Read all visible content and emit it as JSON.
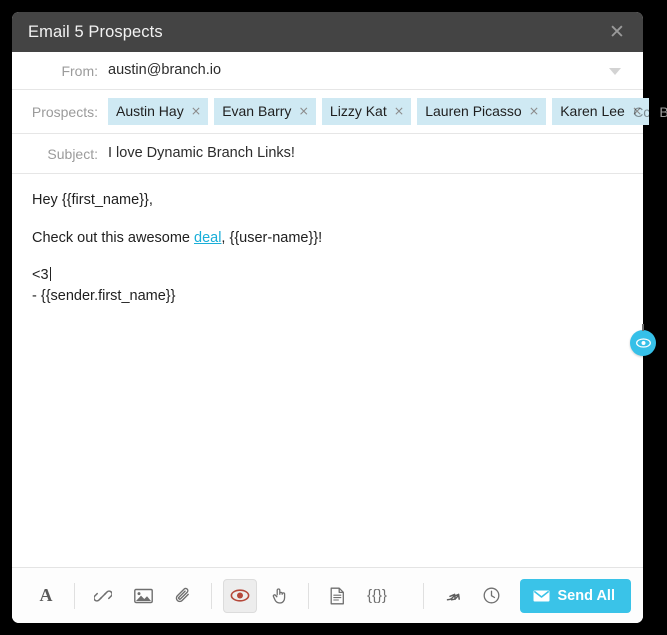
{
  "window": {
    "title": "Email 5 Prospects",
    "close_label": "✕",
    "header_bg": "#444444",
    "accent": "#3ac3e8"
  },
  "fields": {
    "from": {
      "label": "From:",
      "value": "austin@branch.io",
      "dropdown_icon": "chevron-down-icon"
    },
    "prospects": {
      "label": "Prospects:",
      "chips": [
        {
          "name": "Austin Hay",
          "remove": "×"
        },
        {
          "name": "Evan Barry",
          "remove": "×"
        },
        {
          "name": "Lizzy Kat",
          "remove": "×"
        },
        {
          "name": "Lauren Picasso",
          "remove": "×"
        },
        {
          "name": "Karen Lee",
          "remove": "×"
        }
      ],
      "cc_label": "Cc",
      "bcc_label": "Bcc",
      "chip_bg": "#cfe9f3"
    },
    "subject": {
      "label": "Subject:",
      "value": "I love Dynamic Branch Links!"
    }
  },
  "body": {
    "greeting": "Hey {{first_name}},",
    "line2_before": "Check out this awesome ",
    "line2_link": "deal",
    "line2_after": ", {{user-name}}!",
    "sign": "<3",
    "signature": "- {{sender.first_name}}",
    "link_color": "#19aed8"
  },
  "preview_badge": {
    "icon": "eye-icon",
    "color": "#36c0e8"
  },
  "toolbar": {
    "left_tools": [
      {
        "icon": "font-icon",
        "label": "A",
        "active": false
      },
      {
        "icon": "link-icon",
        "label": "",
        "active": false
      },
      {
        "icon": "image-icon",
        "label": "",
        "active": false
      },
      {
        "icon": "paperclip-icon",
        "label": "",
        "active": false
      },
      {
        "icon": "eye-icon",
        "label": "",
        "active": true
      },
      {
        "icon": "hand-pointer-icon",
        "label": "",
        "active": false
      },
      {
        "icon": "document-icon",
        "label": "",
        "active": false
      },
      {
        "icon": "braces-icon",
        "label": "{{}}",
        "active": false
      }
    ],
    "right_tools": [
      {
        "icon": "undo-arrow-icon"
      },
      {
        "icon": "clock-icon"
      }
    ],
    "send": {
      "label": "Send All",
      "icon": "envelope-icon"
    }
  }
}
